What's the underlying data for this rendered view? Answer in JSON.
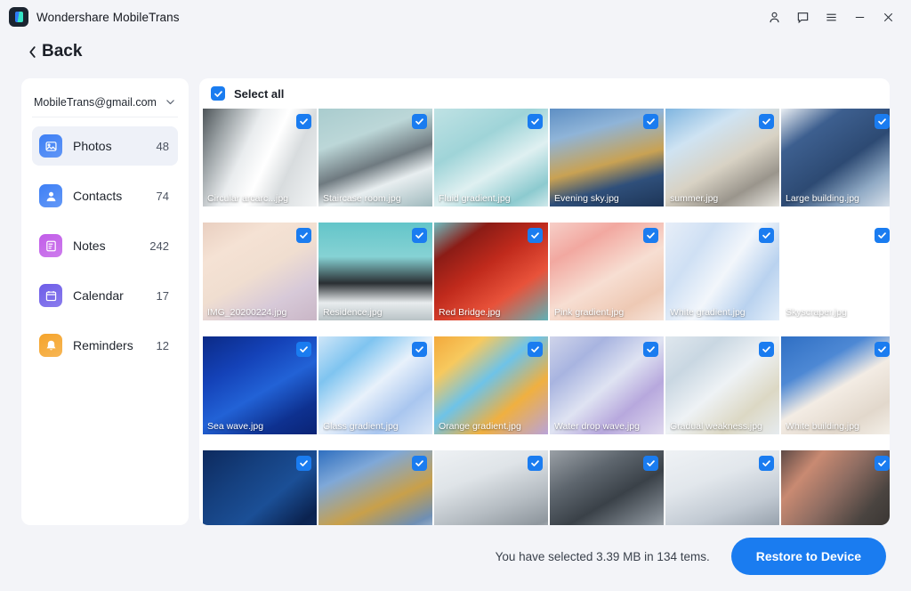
{
  "window": {
    "app_title": "Wondershare MobileTrans",
    "app_icon": "app-logo-icon",
    "controls": [
      {
        "name": "account-icon",
        "label": "Account"
      },
      {
        "name": "feedback-icon",
        "label": "Feedback"
      },
      {
        "name": "menu-icon",
        "label": "Menu"
      },
      {
        "name": "minimize-icon",
        "label": "Minimize"
      },
      {
        "name": "close-icon",
        "label": "Close"
      }
    ]
  },
  "nav": {
    "back_label": "Back"
  },
  "sidebar": {
    "account_email": "MobileTrans@gmail.com",
    "items": [
      {
        "label": "Photos",
        "count": "48",
        "icon": "photos-icon",
        "color": "#3d7ff5",
        "active": true
      },
      {
        "label": "Contacts",
        "count": "74",
        "icon": "contacts-icon",
        "color": "#3d7ff5",
        "active": false
      },
      {
        "label": "Notes",
        "count": "242",
        "icon": "notes-icon",
        "color": "#c15ce8",
        "active": false
      },
      {
        "label": "Calendar",
        "count": "17",
        "icon": "calendar-icon",
        "color": "#6d5ce8",
        "active": false
      },
      {
        "label": "Reminders",
        "count": "12",
        "icon": "reminders-icon",
        "color": "#f5a42b",
        "active": false
      }
    ]
  },
  "content": {
    "select_all_label": "Select all",
    "select_all_checked": true,
    "photos": [
      {
        "name": "Circular arcarc...jpg",
        "checked": true,
        "art": "circular-arc"
      },
      {
        "name": "Staircase room.jpg",
        "checked": true,
        "art": "staircase"
      },
      {
        "name": "Fluid gradient.jpg",
        "checked": true,
        "art": "fluid-teal"
      },
      {
        "name": "Evening sky.jpg",
        "checked": true,
        "art": "evening-sky"
      },
      {
        "name": "summer.jpg",
        "checked": true,
        "art": "summer"
      },
      {
        "name": "Large building.jpg",
        "checked": true,
        "art": "large-building"
      },
      {
        "name": "IMG_20200224.jpg",
        "checked": true,
        "art": "peach-orb"
      },
      {
        "name": "Residence.jpg",
        "checked": true,
        "art": "residence"
      },
      {
        "name": "Red Bridge.jpg",
        "checked": true,
        "art": "red-bridge"
      },
      {
        "name": "Pink gradient.jpg",
        "checked": true,
        "art": "pink-gradient"
      },
      {
        "name": "White gradient.jpg",
        "checked": true,
        "art": "white-gradient"
      },
      {
        "name": "Skyscraper.jpg",
        "checked": true,
        "art": "skyscraper"
      },
      {
        "name": "Sea wave.jpg",
        "checked": true,
        "art": "sea-wave"
      },
      {
        "name": "Glass gradient.jpg",
        "checked": true,
        "art": "glass-gradient"
      },
      {
        "name": "Orange gradient.jpg",
        "checked": true,
        "art": "orange-gradient"
      },
      {
        "name": "Water drop wave.jpg",
        "checked": true,
        "art": "water-drop"
      },
      {
        "name": "Gradual weakness.jpg",
        "checked": true,
        "art": "gradual-weak"
      },
      {
        "name": "White building.jpg",
        "checked": true,
        "art": "white-building"
      },
      {
        "name": "",
        "checked": true,
        "art": "navy-arc"
      },
      {
        "name": "",
        "checked": true,
        "art": "gold-curve"
      },
      {
        "name": "",
        "checked": true,
        "art": "grey-tower"
      },
      {
        "name": "",
        "checked": true,
        "art": "bw-towers"
      },
      {
        "name": "",
        "checked": true,
        "art": "pale-tower"
      },
      {
        "name": "",
        "checked": true,
        "art": "copper-mesh"
      }
    ]
  },
  "footer": {
    "status_text": "You have selected 3.39 MB in 134 tems.",
    "restore_label": "Restore to Device",
    "accent_color": "#1a7cf0"
  }
}
